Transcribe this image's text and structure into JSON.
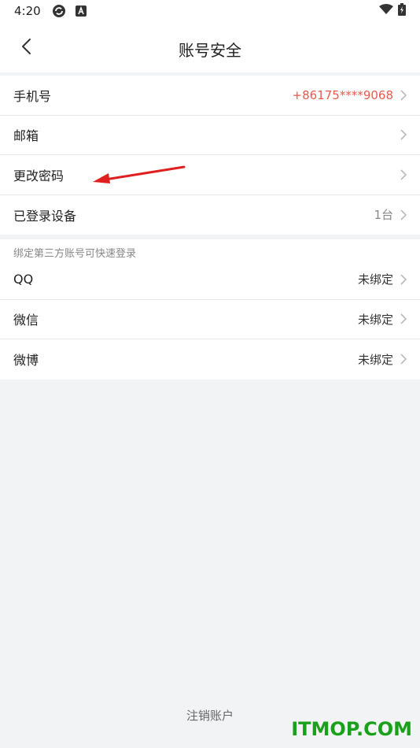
{
  "status_bar": {
    "time": "4:20"
  },
  "header": {
    "title": "账号安全"
  },
  "account_rows": [
    {
      "label": "手机号",
      "value": "+86175****9068"
    },
    {
      "label": "邮箱",
      "value": ""
    },
    {
      "label": "更改密码",
      "value": ""
    },
    {
      "label": "已登录设备",
      "value": "1台"
    }
  ],
  "third_party": {
    "section_label": "绑定第三方账号可快速登录",
    "rows": [
      {
        "label": "QQ",
        "value": "未绑定"
      },
      {
        "label": "微信",
        "value": "未绑定"
      },
      {
        "label": "微博",
        "value": "未绑定"
      }
    ]
  },
  "footer": {
    "cancel_account": "注销账户"
  },
  "watermark": "ITMOP.COM",
  "colors": {
    "phone_value": "#e85a4f",
    "annotation_arrow": "#e02020",
    "watermark": "#1aa01a"
  }
}
